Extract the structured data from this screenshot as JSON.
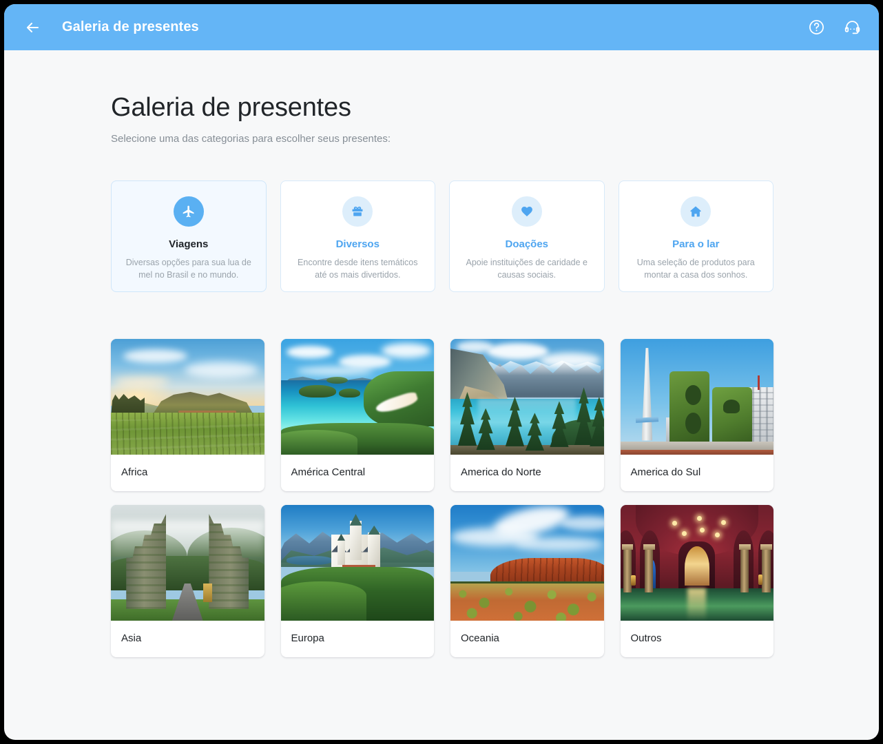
{
  "appbar": {
    "back_label": "back-arrow",
    "title": "Galeria de presentes",
    "help_label": "help-icon",
    "support_label": "support-headset-icon"
  },
  "page": {
    "title": "Galeria de presentes",
    "subtitle": "Selecione uma das categorias para escolher seus presentes:",
    "accent_color": "#64b5f6",
    "active_card_bg": "#f3f9ff",
    "card_border": "#d7e9f9",
    "title_color": "#212529",
    "muted_color": "#868e96"
  },
  "categories": [
    {
      "icon": "airplane-icon",
      "title": "Viagens",
      "desc": "Diversas opções para sua lua de mel no Brasil e no mundo.",
      "active": true
    },
    {
      "icon": "gift-icon",
      "title": "Diversos",
      "desc": "Encontre desde itens temáticos até os mais divertidos.",
      "active": false
    },
    {
      "icon": "heart-icon",
      "title": "Doações",
      "desc": "Apoie instituições de caridade e causas sociais.",
      "active": false
    },
    {
      "icon": "home-icon",
      "title": "Para o lar",
      "desc": "Uma seleção de produtos para montar a casa dos sonhos.",
      "active": false
    }
  ],
  "destinations": [
    {
      "label": "Africa",
      "photo": "vineyard-mountain-sunset"
    },
    {
      "label": "América Central",
      "photo": "caribbean-turquoise-bay"
    },
    {
      "label": "America do Norte",
      "photo": "moraine-lake-mountains"
    },
    {
      "label": "America do Sul",
      "photo": "buenos-aires-obelisk"
    },
    {
      "label": "Asia",
      "photo": "bali-handara-gate"
    },
    {
      "label": "Europa",
      "photo": "neuschwanstein-castle"
    },
    {
      "label": "Oceania",
      "photo": "uluru-outback"
    },
    {
      "label": "Outros",
      "photo": "arab-baths-hammam"
    }
  ]
}
